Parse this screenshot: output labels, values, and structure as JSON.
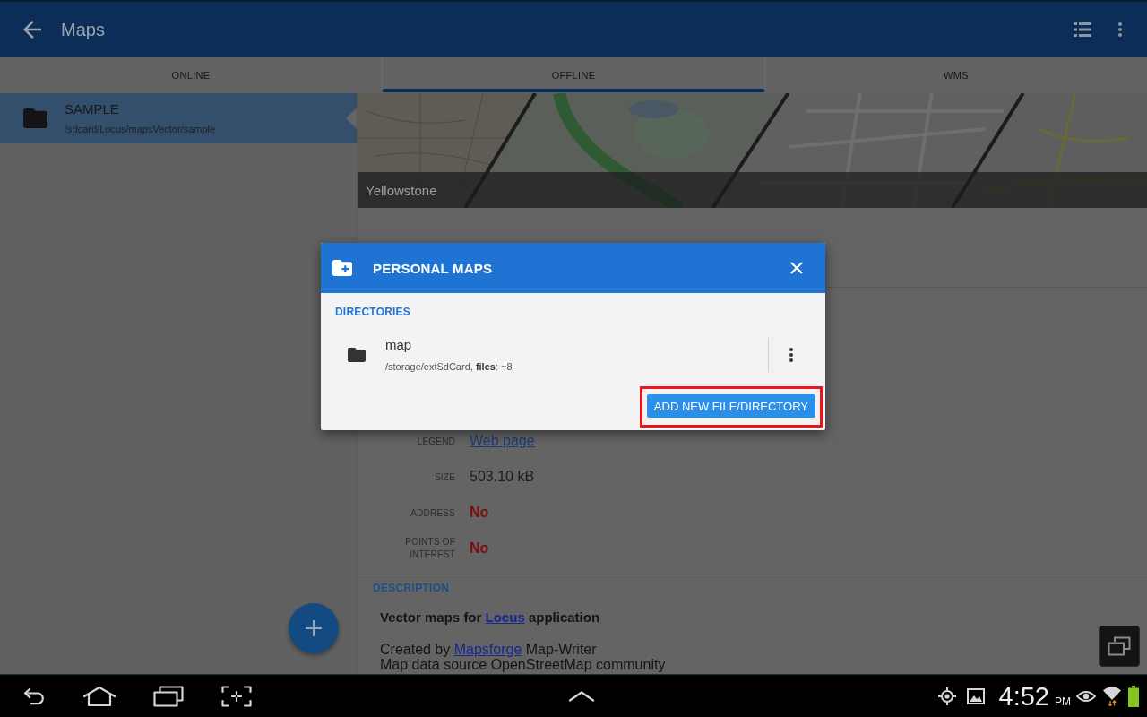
{
  "app_bar": {
    "title": "Maps"
  },
  "tabs": [
    {
      "label": "ONLINE",
      "selected": false
    },
    {
      "label": "OFFLINE",
      "selected": true
    },
    {
      "label": "WMS",
      "selected": false
    }
  ],
  "sidebar": {
    "items": [
      {
        "title": "SAMPLE",
        "path": "/sdcard/Locus/mapsVector/sample",
        "selected": true
      }
    ]
  },
  "map_preview": {
    "caption": "Yellowstone"
  },
  "details": {
    "rows": [
      {
        "label": "LEGEND",
        "value": "Web page",
        "kind": "link"
      },
      {
        "label": "SIZE",
        "value": "503.10 kB",
        "kind": "text"
      },
      {
        "label": "ADDRESS",
        "value": "No",
        "kind": "flag"
      },
      {
        "label": "POINTS OF INTEREST",
        "value": "No",
        "kind": "flag"
      }
    ]
  },
  "description": {
    "heading": "DESCRIPTION",
    "paragraphs": [
      {
        "kind": "lead",
        "parts": [
          {
            "text": "Vector maps for ",
            "link": false
          },
          {
            "text": "Locus",
            "link": true
          },
          {
            "text": " application",
            "link": false
          }
        ]
      },
      {
        "kind": "body",
        "parts": [
          {
            "text": "Created by ",
            "link": false
          },
          {
            "text": "Mapsforge",
            "link": true
          },
          {
            "text": " Map-Writer",
            "link": false
          }
        ]
      },
      {
        "kind": "body",
        "parts": [
          {
            "text": "Map data source OpenStreetMap community",
            "link": false
          }
        ]
      }
    ]
  },
  "dialog": {
    "title": "PERSONAL MAPS",
    "section": "DIRECTORIES",
    "directories": [
      {
        "name": "map",
        "detail": "/storage/extSdCard, **files**: ~8"
      }
    ],
    "button": {
      "label": "ADD NEW FILE/DIRECTORY",
      "highlighted": true
    }
  },
  "system_bar": {
    "time": "4:52",
    "meridiem": "PM"
  }
}
